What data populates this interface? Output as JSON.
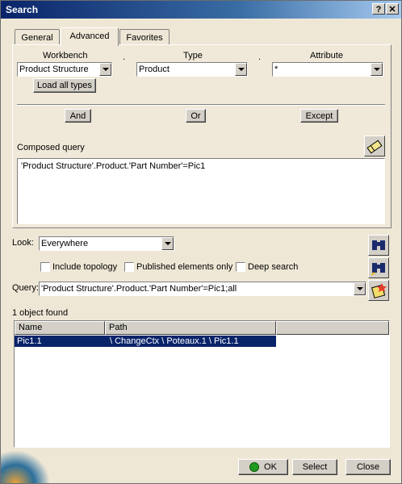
{
  "window": {
    "title": "Search",
    "help_label": "?",
    "close_label": "✕"
  },
  "tabs": [
    {
      "label": "General"
    },
    {
      "label": "Advanced"
    },
    {
      "label": "Favorites"
    }
  ],
  "advanced": {
    "workbench_label": "Workbench",
    "type_label": "Type",
    "attribute_label": "Attribute",
    "dot_separator": ".",
    "workbench_value": "Product Structure",
    "type_value": "Product",
    "attribute_value": "*",
    "load_all_types_label": "Load all types",
    "and_label": "And",
    "or_label": "Or",
    "except_label": "Except",
    "composed_query_label": "Composed query",
    "composed_query_text": "'Product Structure'.Product.'Part Number'=Pic1"
  },
  "look": {
    "label": "Look:",
    "value": "Everywhere",
    "include_topology": "Include topology",
    "published_only": "Published elements only",
    "deep_search": "Deep search"
  },
  "query": {
    "label": "Query:",
    "value": "'Product Structure'.Product.'Part Number'=Pic1;all"
  },
  "results": {
    "status": "1 object found",
    "columns": [
      "Name",
      "Path"
    ],
    "rows": [
      {
        "name": "Pic1.1",
        "path": "\\ ChangeCtx \\ Poteaux.1 \\ Pic1.1"
      }
    ]
  },
  "footer": {
    "ok_label": "OK",
    "select_label": "Select",
    "close_label": "Close"
  },
  "colors": {
    "title_start": "#0a246a",
    "selection": "#0a246a",
    "ok_indicator": "#1f9a1f"
  }
}
